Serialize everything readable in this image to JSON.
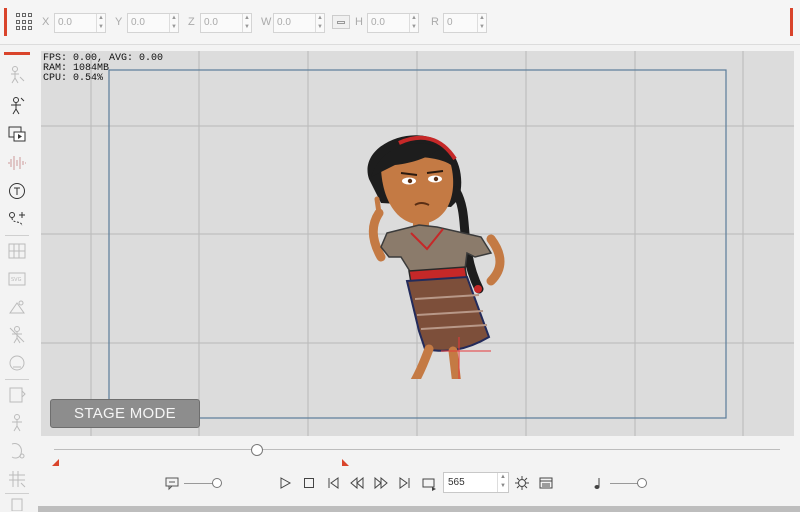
{
  "transform_bar": {
    "grid_icon": "grid-icon",
    "fields": [
      {
        "label": "X",
        "value": "0.0"
      },
      {
        "label": "Y",
        "value": "0.0"
      },
      {
        "label": "Z",
        "value": "0.0"
      },
      {
        "label": "W",
        "value": "0.0"
      },
      {
        "label": "H",
        "value": "0.0"
      },
      {
        "label": "R",
        "value": "0"
      }
    ],
    "link_icon": "link-aspect-icon"
  },
  "sidebar": {
    "tools": [
      "actor-icon",
      "bone-edit-icon",
      "scene-media-icon",
      "audio-icon",
      "text-icon",
      "motion-path-icon",
      "grid-layout-icon",
      "svg-icon",
      "prop-icon",
      "character-icon",
      "head-icon",
      "mirror-icon",
      "pose-icon",
      "face-icon",
      "transform-icon",
      "layer-icon"
    ]
  },
  "stage": {
    "stats": {
      "fps": "FPS: 0.00, AVG: 0.00",
      "ram": "RAM: 1084MB",
      "cpu": "CPU: 0.54%"
    },
    "mode_button": "STAGE MODE"
  },
  "timeline": {
    "playhead_position": 0.28
  },
  "controls": {
    "frame_value": "565",
    "icons": [
      "subtitle-icon",
      "play-icon",
      "stop-icon",
      "first-frame-icon",
      "prev-key-icon",
      "next-key-icon",
      "last-frame-icon",
      "loop-icon",
      "settings-icon",
      "list-icon",
      "music-note-icon"
    ]
  },
  "colors": {
    "accent": "#d9442b",
    "stage_bg": "#dcdcdc",
    "camera_frame": "#5b7c99"
  }
}
